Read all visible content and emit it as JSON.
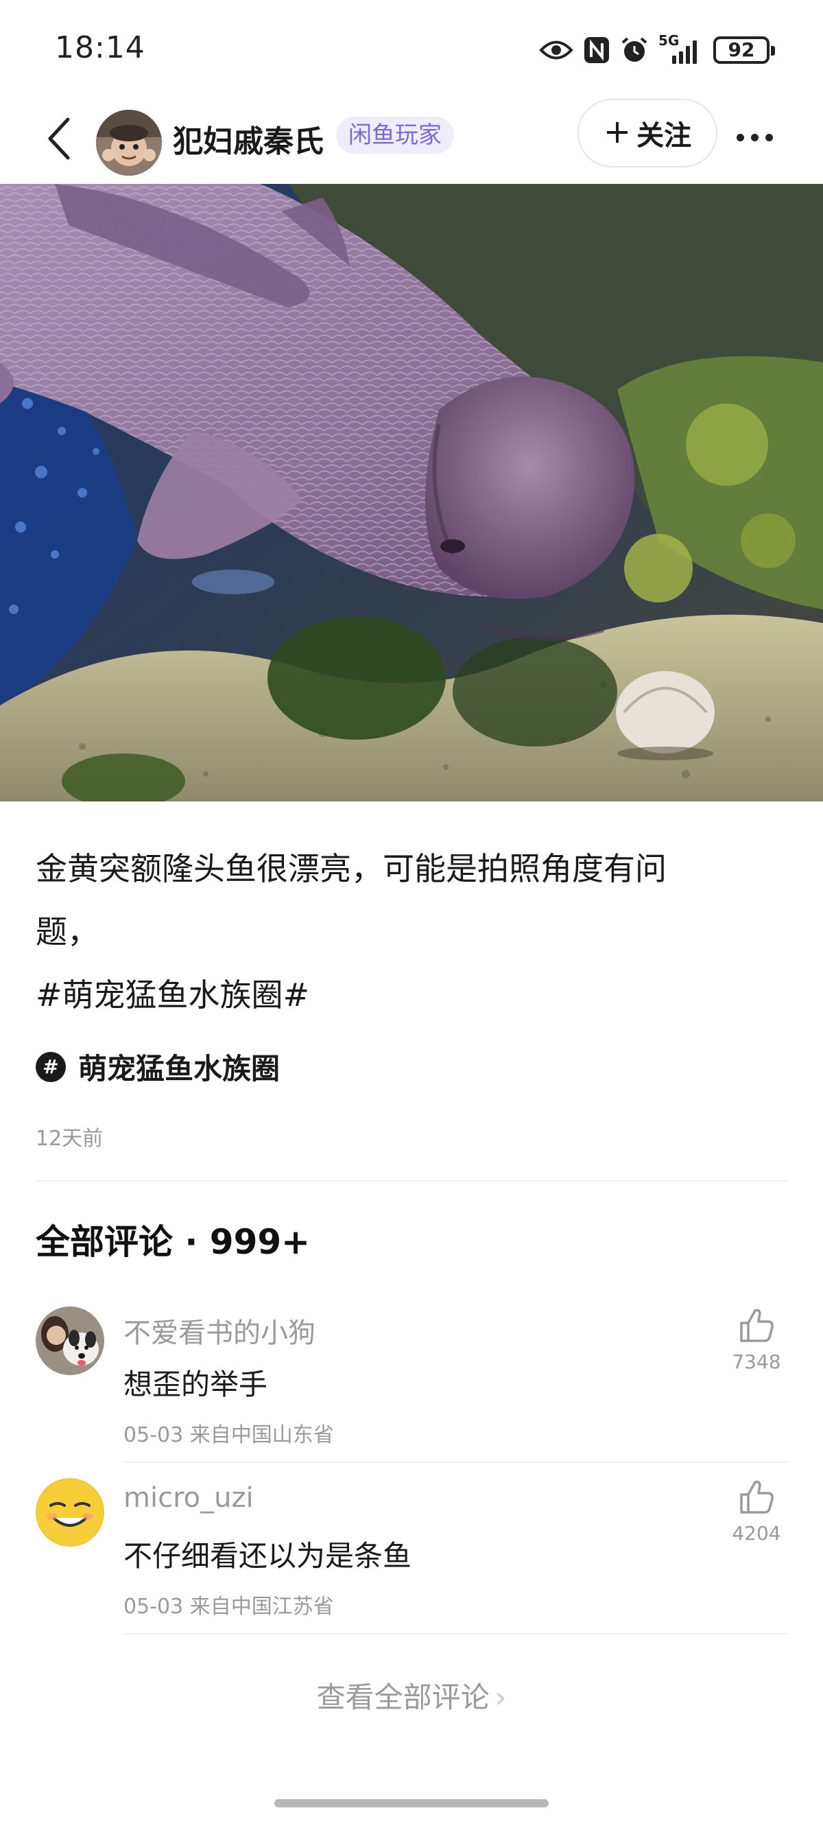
{
  "status_bar": {
    "time": "18:14",
    "network": "5G",
    "battery": "92",
    "icons": [
      "eye-icon",
      "nfc-icon",
      "alarm-icon",
      "signal-5g-icon",
      "battery-icon"
    ]
  },
  "header": {
    "back_icon": "chevron-left-icon",
    "author_name": "犯妇戚秦氏",
    "author_badge": "闲鱼玩家",
    "follow_label": "关注",
    "more_icon": "more-dots-icon"
  },
  "post": {
    "text_line1": "金黄突额隆头鱼很漂亮，可能是拍照角度有问",
    "text_line2": "题，",
    "text_line3": "#萌宠猛鱼水族圈#",
    "topic_icon": "#",
    "topic_label": "萌宠猛鱼水族圈",
    "time_ago": "12天前"
  },
  "comments": {
    "title": "全部评论 · 999+",
    "items": [
      {
        "user": "不爱看书的小狗",
        "text": "想歪的举手",
        "meta": "05-03 来自中国山东省",
        "likes": "7348"
      },
      {
        "user": "micro_uzi",
        "text": "不仔细看还以为是条鱼",
        "meta": "05-03 来自中国江苏省",
        "likes": "4204"
      }
    ],
    "view_all_label": "查看全部评论"
  },
  "colors": {
    "badge_bg": "#efedfb",
    "badge_text": "#7b6bd8",
    "muted_text": "#9a9a9a"
  }
}
